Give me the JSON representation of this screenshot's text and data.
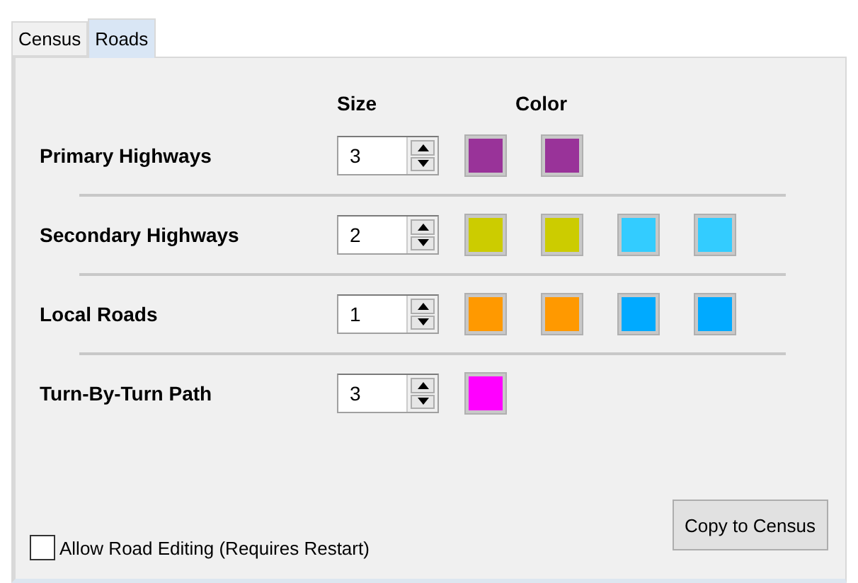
{
  "tabs": [
    {
      "label": "Census",
      "selected": false
    },
    {
      "label": "Roads",
      "selected": true
    }
  ],
  "headers": {
    "size": "Size",
    "color_heading": "Color"
  },
  "roads": [
    {
      "name": "Primary Highways",
      "size": "3",
      "swatches": [
        {
          "color": "#993399"
        },
        {
          "color": "#993399"
        }
      ]
    },
    {
      "name": "Secondary Highways",
      "size": "2",
      "swatches": [
        {
          "color": "#cccc00"
        },
        {
          "color": "#cccc00"
        },
        {
          "color": "#33ccff"
        },
        {
          "color": "#33ccff"
        }
      ]
    },
    {
      "name": "Local Roads",
      "size": "1",
      "swatches": [
        {
          "color": "#ff9900"
        },
        {
          "color": "#ff9900"
        },
        {
          "color": "#00aaff"
        },
        {
          "color": "#00aaff"
        }
      ]
    },
    {
      "name": "Turn-By-Turn Path",
      "size": "3",
      "swatches": [
        {
          "color": "#ff00ff"
        }
      ]
    }
  ],
  "allow_editing": {
    "label": "Allow Road Editing (Requires Restart)",
    "checked": false
  },
  "copy_button": "Copy to Census"
}
